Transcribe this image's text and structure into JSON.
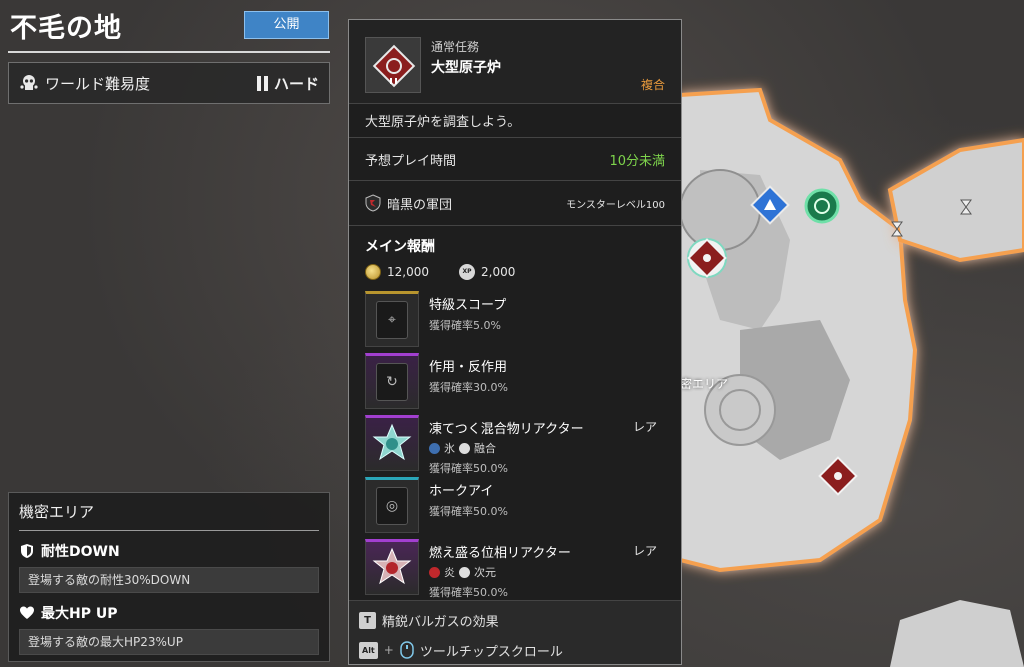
{
  "header": {
    "world_title": "不毛の地",
    "publish_label": "公開"
  },
  "difficulty": {
    "label": "ワールド難易度",
    "value": "ハード",
    "icon": "skull-icon"
  },
  "area": {
    "title": "機密エリア",
    "modifiers": [
      {
        "icon": "shield-icon",
        "title": "耐性DOWN",
        "desc": "登場する敵の耐性30%DOWN"
      },
      {
        "icon": "heart-icon",
        "title": "最大HP UP",
        "desc": "登場する敵の最大HP23%UP"
      }
    ]
  },
  "mission": {
    "category": "通常任務",
    "name": "大型原子炉",
    "type": "複合",
    "description": "大型原子炉を調査しよう。",
    "time_label": "予想プレイ時間",
    "time_value": "10分未満",
    "enemy_faction": "暗黒の軍団",
    "monster_level": "モンスターレベル100",
    "rewards_title": "メイン報酬",
    "gold": "12,000",
    "xp_label": "XP",
    "xp": "2,000",
    "rewards": [
      {
        "name": "特級スコープ",
        "rate": "獲得確率5.0%",
        "rarity": "",
        "tags": []
      },
      {
        "name": "作用・反作用",
        "rate": "獲得確率30.0%",
        "rarity": "",
        "tags": []
      },
      {
        "name": "凍てつく混合物リアクター",
        "rate": "獲得確率50.0%",
        "rarity": "レア",
        "tags": [
          "氷",
          "融合"
        ]
      },
      {
        "name": "ホークアイ",
        "rate": "獲得確率50.0%",
        "rarity": "",
        "tags": []
      },
      {
        "name": "燃え盛る位相リアクター",
        "rate": "獲得確率50.0%",
        "rarity": "レア",
        "tags": [
          "炎",
          "次元"
        ]
      }
    ]
  },
  "footer": {
    "key_t": "T",
    "effect_label": "精鋭バルガスの効果",
    "key_alt": "Alt",
    "plus": "+",
    "scroll_label": "ツールチップスクロール"
  },
  "map": {
    "area_label": "密エリア"
  },
  "colors": {
    "accent_blue": "#3f84c6",
    "time_green": "#7ed44c",
    "mission_type_orange": "#e89a3c",
    "map_glow": "#f5a050"
  }
}
